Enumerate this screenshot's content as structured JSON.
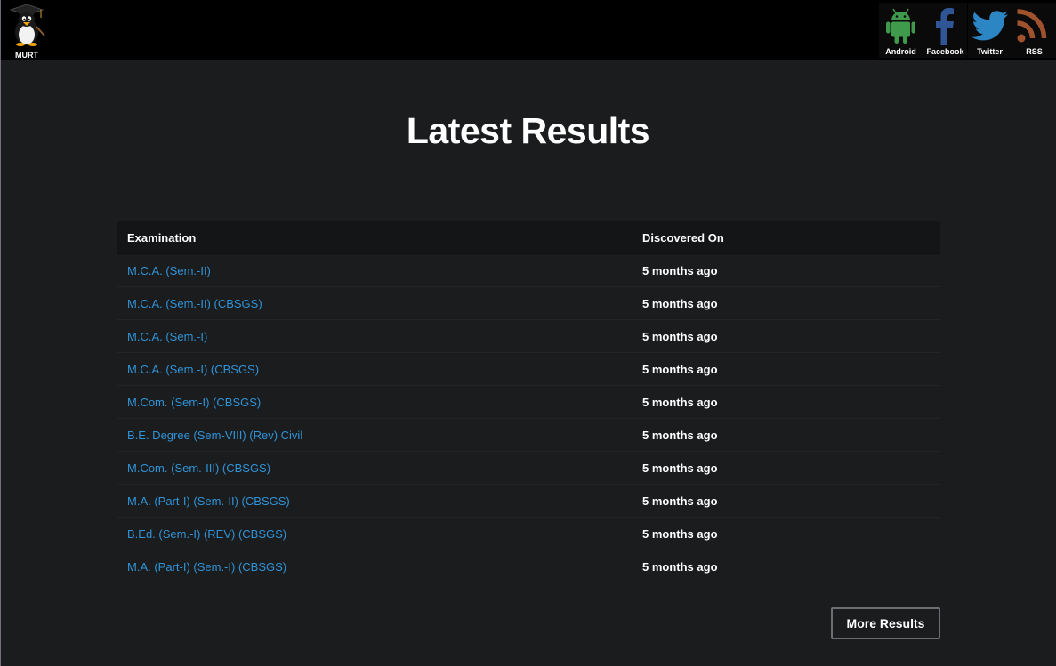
{
  "header": {
    "logo_label": "MURT",
    "social": [
      {
        "label": "Android",
        "icon": "android-icon",
        "color": "#3ddc84"
      },
      {
        "label": "Facebook",
        "icon": "facebook-icon",
        "color": "#3b5998"
      },
      {
        "label": "Twitter",
        "icon": "twitter-icon",
        "color": "#1da1f2"
      },
      {
        "label": "RSS",
        "icon": "rss-icon",
        "color": "#a0522d"
      }
    ]
  },
  "main": {
    "title": "Latest Results",
    "table": {
      "columns": [
        "Examination",
        "Discovered On"
      ],
      "rows": [
        {
          "exam": "M.C.A. (Sem.-II)",
          "discovered": "5 months ago"
        },
        {
          "exam": "M.C.A. (Sem.-II) (CBSGS)",
          "discovered": "5 months ago"
        },
        {
          "exam": "M.C.A. (Sem.-I)",
          "discovered": "5 months ago"
        },
        {
          "exam": "M.C.A. (Sem.-I) (CBSGS)",
          "discovered": "5 months ago"
        },
        {
          "exam": "M.Com. (Sem-I) (CBSGS)",
          "discovered": "5 months ago"
        },
        {
          "exam": "B.E. Degree (Sem-VIII) (Rev) Civil",
          "discovered": "5 months ago"
        },
        {
          "exam": "M.Com. (Sem.-III) (CBSGS)",
          "discovered": "5 months ago"
        },
        {
          "exam": "M.A. (Part-I) (Sem.-II) (CBSGS)",
          "discovered": "5 months ago"
        },
        {
          "exam": "B.Ed. (Sem.-I) (REV) (CBSGS)",
          "discovered": "5 months ago"
        },
        {
          "exam": "M.A. (Part-I) (Sem.-I) (CBSGS)",
          "discovered": "5 months ago"
        }
      ]
    },
    "more_button": "More Results"
  },
  "colors": {
    "background": "#1b1c1e",
    "topbar": "#000000",
    "link": "#2f94d8",
    "header_row": "#141517"
  }
}
